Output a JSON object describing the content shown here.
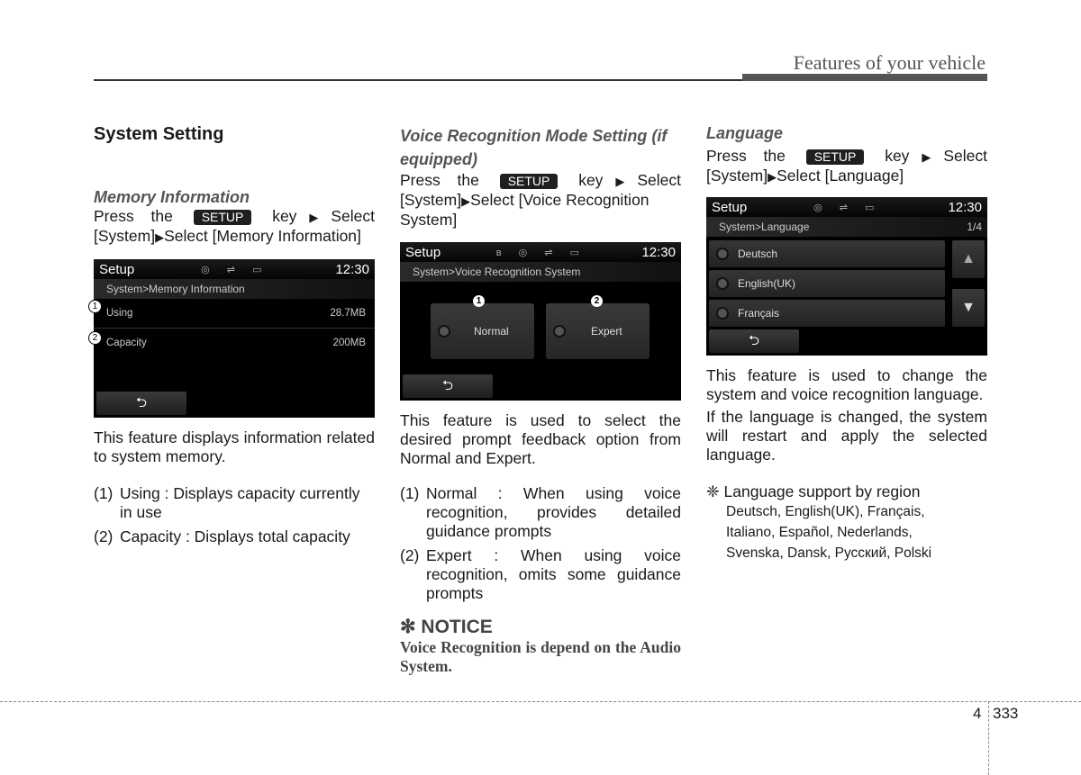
{
  "header": {
    "title": "Features of your vehicle"
  },
  "col1": {
    "heading": "System Setting",
    "subheading": "Memory Information",
    "instr_press": "Press the",
    "key": "SETUP",
    "instr_key": "key",
    "instr_select": "Select",
    "instr_line2": "[System]",
    "instr_line2b": "Select [Memory Information]",
    "screen": {
      "title": "Setup",
      "icons": "◎ ⇌ ▭",
      "time": "12:30",
      "crumb": "System>Memory Information",
      "rows": [
        {
          "num": "1",
          "label": "Using",
          "value": "28.7MB"
        },
        {
          "num": "2",
          "label": "Capacity",
          "value": "200MB"
        }
      ],
      "back": "⮌"
    },
    "desc": "This feature displays information related to system memory.",
    "items": [
      {
        "n": "(1)",
        "t": "Using : Displays capacity currently in use"
      },
      {
        "n": "(2)",
        "t": "Capacity : Displays total capacity"
      }
    ]
  },
  "col2": {
    "heading": "Voice Recognition Mode Setting (if equipped)",
    "instr_press": "Press the",
    "key": "SETUP",
    "instr_key": "key",
    "instr_select": "Select",
    "instr_line2": "[System]",
    "instr_line2b": "Select [Voice Recognition System]",
    "screen": {
      "title": "Setup",
      "icons": "ʙ ◎ ⇌ ▭",
      "time": "12:30",
      "crumb": "System>Voice Recognition System",
      "options": [
        {
          "num": "1",
          "label": "Normal"
        },
        {
          "num": "2",
          "label": "Expert"
        }
      ],
      "back": "⮌"
    },
    "desc": "This feature is used to select the desired prompt feedback option from Normal and Expert.",
    "items": [
      {
        "n": "(1)",
        "t": "Normal : When using voice recognition, provides detailed guidance prompts"
      },
      {
        "n": "(2)",
        "t": "Expert : When using voice recognition, omits some guidance prompts"
      }
    ],
    "notice_title": "✻ NOTICE",
    "notice_body": "Voice Recognition is depend on the Audio System."
  },
  "col3": {
    "heading": "Language",
    "instr_press": "Press the",
    "key": "SETUP",
    "instr_key": "key",
    "instr_select": "Select",
    "instr_line2": "[System]",
    "instr_line2b": "Select [Language]",
    "screen": {
      "title": "Setup",
      "icons": "◎ ⇌ ▭",
      "time": "12:30",
      "crumb": "System>Language",
      "page": "1/4",
      "languages": [
        "Deutsch",
        "English(UK)",
        "Français"
      ],
      "up": "▲",
      "down": "▼",
      "back": "⮌"
    },
    "desc1": "This feature is used to change the system and voice recognition language.",
    "desc2": "If the language is changed, the system will restart and apply the selected language.",
    "support_title": "❈ Language support by region",
    "support_lines": [
      "Deutsch, English(UK), Français,",
      "Italiano, Español, Nederlands,",
      "Svenska, Dansk, Русский, Polski"
    ]
  },
  "footer": {
    "section": "4",
    "page": "333"
  }
}
